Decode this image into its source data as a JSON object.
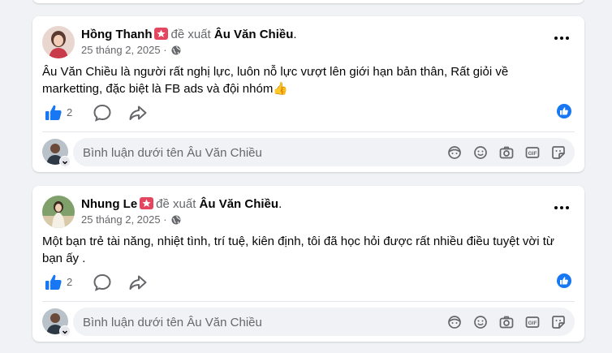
{
  "posts": [
    {
      "author": "Hồng Thanh",
      "verb": "đề xuất",
      "target": "Âu Văn Chiều",
      "target_suffix": ".",
      "date": "25 tháng 2, 2025",
      "date_sep": " · ",
      "text": "Âu Văn Chiều là người rất nghị lực, luôn nỗ lực vượt lên giới hạn bản thân, Rất giỏi về marketting, đặc biệt là FB ads và đội nhóm👍",
      "like_count": "2"
    },
    {
      "author": "Nhung Le",
      "verb": "đề xuất",
      "target": "Âu Văn Chiều",
      "target_suffix": ".",
      "date": "25 tháng 2, 2025",
      "date_sep": " · ",
      "text": "Một bạn trẻ tài năng, nhiệt tình, trí tuệ, kiên định, tôi đã học hỏi được rất nhiều điều tuyệt vời từ bạn ấy .",
      "like_count": "2"
    }
  ],
  "comment": {
    "placeholder": "Bình luận dưới tên Âu Văn Chiều"
  },
  "icons": {
    "like": "thumbs-up-icon",
    "comment": "comment-bubble-icon",
    "share": "share-arrow-icon",
    "more": "more-dots-icon",
    "privacy": "globe-icon",
    "reaction": "like-reaction-icon",
    "avatar_sticker": "avatar-sticker-icon",
    "emoji": "emoji-icon",
    "camera": "camera-icon",
    "gif": "gif-icon",
    "sticker": "sticker-icon"
  },
  "colors": {
    "accent": "#1877f2",
    "badge": "#e4455f",
    "secondary_text": "#65676b",
    "background": "#f0f2f5"
  }
}
